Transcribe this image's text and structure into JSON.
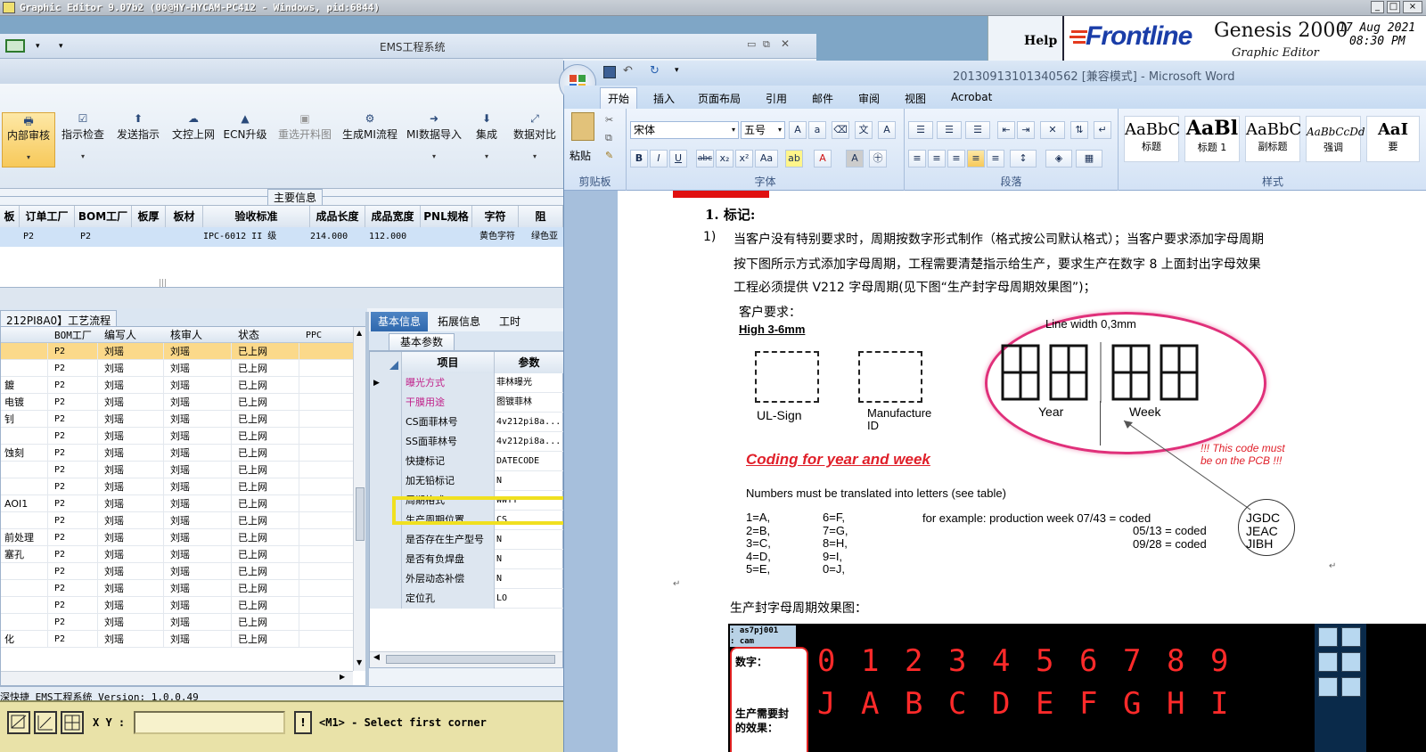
{
  "genesis": {
    "titlebar": "Graphic Editor 9.07b2 (00@HY-HYCAM-PC412 - Windows, pid:6844)",
    "help": "Help",
    "frontline": "Frontline",
    "product": "Genesis 2000",
    "subtitle": "Graphic Editor",
    "date": "17 Aug 2021",
    "time": "08:30 PM",
    "console": {
      "xy_label": "X Y :",
      "status": "<M1> - Select first corner"
    }
  },
  "ems": {
    "title": "EMS工程系统",
    "toolbar": [
      {
        "label": "内部审核",
        "icon": "printer-icon",
        "active": true
      },
      {
        "label": "指示检查",
        "icon": "check-icon"
      },
      {
        "label": "发送指示",
        "icon": "upload-icon"
      },
      {
        "label": "文控上网",
        "icon": "cloud-upload-icon"
      },
      {
        "label": "ECN升级",
        "icon": "ecn-icon"
      },
      {
        "label": "重选开料图",
        "icon": "image-icon"
      },
      {
        "label": "生成MI流程",
        "icon": "gears-icon"
      },
      {
        "label": "MI数据导入",
        "icon": "import-icon"
      },
      {
        "label": "集成",
        "icon": "download-icon"
      },
      {
        "label": "数据对比",
        "icon": "compare-icon"
      }
    ],
    "main_info_label": "主要信息",
    "main_table": {
      "headers": [
        "板",
        "订单工厂",
        "BOM工厂",
        "板厚",
        "板材",
        "验收标准",
        "成品长度",
        "成品宽度",
        "PNL规格",
        "字符",
        "阻"
      ],
      "row": [
        "",
        "P2",
        "P2",
        "",
        "",
        "IPC-6012 II 级",
        "214.000",
        "112.000",
        "",
        "黄色字符",
        "绿色亚"
      ]
    },
    "process_tab": "212PI8A0】工艺流程",
    "process_table": {
      "headers": [
        "",
        "BOM工厂",
        "编写人",
        "核审人",
        "状态",
        "PPC"
      ],
      "rows": [
        [
          "",
          "P2",
          "刘瑶",
          "刘瑶",
          "已上网",
          ""
        ],
        [
          "",
          "P2",
          "刘瑶",
          "刘瑶",
          "已上网",
          ""
        ],
        [
          "鍍",
          "P2",
          "刘瑶",
          "刘瑶",
          "已上网",
          ""
        ],
        [
          "电镀",
          "P2",
          "刘瑶",
          "刘瑶",
          "已上网",
          ""
        ],
        [
          "钊",
          "P2",
          "刘瑶",
          "刘瑶",
          "已上网",
          ""
        ],
        [
          "",
          "P2",
          "刘瑶",
          "刘瑶",
          "已上网",
          ""
        ],
        [
          "蚀刻",
          "P2",
          "刘瑶",
          "刘瑶",
          "已上网",
          ""
        ],
        [
          "",
          "P2",
          "刘瑶",
          "刘瑶",
          "已上网",
          ""
        ],
        [
          "",
          "P2",
          "刘瑶",
          "刘瑶",
          "已上网",
          ""
        ],
        [
          "AOI1",
          "P2",
          "刘瑶",
          "刘瑶",
          "已上网",
          ""
        ],
        [
          "",
          "P2",
          "刘瑶",
          "刘瑶",
          "已上网",
          ""
        ],
        [
          "前处理",
          "P2",
          "刘瑶",
          "刘瑶",
          "已上网",
          ""
        ],
        [
          "塞孔",
          "P2",
          "刘瑶",
          "刘瑶",
          "已上网",
          ""
        ],
        [
          "",
          "P2",
          "刘瑶",
          "刘瑶",
          "已上网",
          ""
        ],
        [
          "",
          "P2",
          "刘瑶",
          "刘瑶",
          "已上网",
          ""
        ],
        [
          "",
          "P2",
          "刘瑶",
          "刘瑶",
          "已上网",
          ""
        ],
        [
          "",
          "P2",
          "刘瑶",
          "刘瑶",
          "已上网",
          ""
        ],
        [
          "化",
          "P2",
          "刘瑶",
          "刘瑶",
          "已上网",
          ""
        ]
      ]
    },
    "info_tabs": [
      "基本信息",
      "拓展信息",
      "工时"
    ],
    "params_tab": "基本参数",
    "params_headers": [
      "项目",
      "参数"
    ],
    "params": [
      {
        "item": "曝光方式",
        "value": "菲林曝光",
        "pink": true
      },
      {
        "item": "干膜用途",
        "value": "图镀菲林",
        "pink": true
      },
      {
        "item": "CS面菲林号",
        "value": "4v212pi8a..."
      },
      {
        "item": "SS面菲林号",
        "value": "4v212pi8a..."
      },
      {
        "item": "快捷标记",
        "value": "DATECODE"
      },
      {
        "item": "加无铅标记",
        "value": "N"
      },
      {
        "item": "周期格式",
        "value": "WWYY"
      },
      {
        "item": "生产周期位置",
        "value": "CS"
      },
      {
        "item": "是否存在生产型号",
        "value": "N"
      },
      {
        "item": "是否有负焊盘",
        "value": "N"
      },
      {
        "item": "外层动态补偿",
        "value": "N"
      },
      {
        "item": "定位孔",
        "value": "LO"
      }
    ],
    "status_bar": "深快捷 EMS工程系统 Version: 1.0.0.49"
  },
  "word": {
    "title": "20130913101340562 [兼容模式] - Microsoft Word",
    "tabs": [
      "开始",
      "插入",
      "页面布局",
      "引用",
      "邮件",
      "审阅",
      "视图",
      "Acrobat"
    ],
    "font_name": "宋体",
    "font_size": "五号",
    "groups": [
      "剪贴板",
      "字体",
      "段落",
      "样式"
    ],
    "paste_label": "粘贴",
    "styles": [
      {
        "sample": "AaBbC",
        "name": "标题"
      },
      {
        "sample": "AaBl",
        "name": "标题 1"
      },
      {
        "sample": "AaBbC",
        "name": "副标题"
      },
      {
        "sample": "AaBbCcDd",
        "name": "强调"
      },
      {
        "sample": "AaI",
        "name": "要"
      }
    ],
    "doc": {
      "heading": "1. 标记:",
      "para_num": "1)",
      "para_line1": "当客户没有特别要求时，周期按数字形式制作（格式按公司默认格式）；当客户要求添加字母周期",
      "para_line2": "按下图所示方式添加字母周期，工程需要清楚指示给生产，要求生产在数字 8 上面封出字母效果",
      "para_line3": "工程必须提供 V212 字母周期(见下图“生产封字母周期效果图”)；",
      "customer_req": "客户要求：",
      "high": "High 3-6mm",
      "line_width": "Line width 0,3mm",
      "ul_sign": "UL-Sign",
      "manufacture": "Manufacture",
      "manufacture2": "ID",
      "year": "Year",
      "week": "Week",
      "coding_title": "Coding for year and week",
      "note1": "!!! This code must",
      "note2": "be on the PCB !!!",
      "numbers_line": "Numbers must be translated into letters (see table)",
      "map_col1": [
        "1=A,",
        "2=B,",
        "3=C,",
        "4=D,",
        "5=E,"
      ],
      "map_col2": [
        "6=F,",
        "7=G,",
        "8=H,",
        "9=I,",
        "0=J,"
      ],
      "example_intro": "for example: production week 07/43  = coded",
      "example_line2": "05/13  = coded",
      "example_line3": "09/28  = coded",
      "codes": [
        "JGDC",
        "JEAC",
        "JIBH"
      ],
      "effect_title": "生产封字母周期效果图：",
      "embed_tag1": ": as7pj001",
      "embed_tag2": ": cam",
      "embed_digits_label": "数字：",
      "embed_effect_label1": "生产需要封",
      "embed_effect_label2": "的效果：",
      "digits": [
        "0",
        "1",
        "2",
        "3",
        "4",
        "5",
        "6",
        "7",
        "8",
        "9"
      ],
      "letters": [
        "J",
        "A",
        "B",
        "C",
        "D",
        "E",
        "F",
        "G",
        "H",
        "I"
      ]
    }
  }
}
